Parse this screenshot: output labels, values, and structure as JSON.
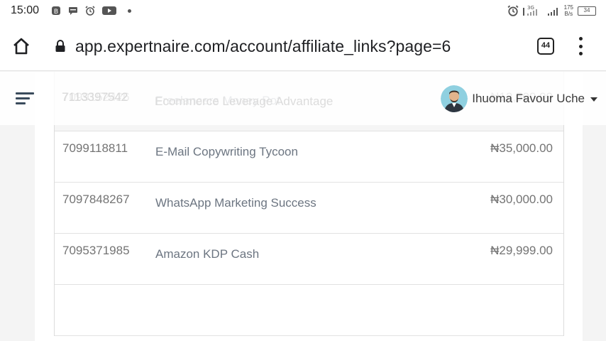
{
  "status_bar": {
    "time": "15:00",
    "network": "3G",
    "speed_value": "175",
    "speed_unit": "B/s",
    "battery": "34"
  },
  "browser": {
    "url": "app.expertnaire.com/account/affiliate_links?page=6",
    "tab_count": "44"
  },
  "header": {
    "user_name": "Ihuoma Favour Uche",
    "ghost_row": {
      "id": "7113397542",
      "name": "Ecommerce Leverage Advantage"
    }
  },
  "rows": [
    {
      "id": "7099152426",
      "name": "Freelancers Money Pot",
      "price": "₦12,500.00"
    },
    {
      "id": "7099118811",
      "name": "E-Mail Copywriting Tycoon",
      "price": "₦35,000.00"
    },
    {
      "id": "7097848267",
      "name": "WhatsApp Marketing Success",
      "price": "₦30,000.00"
    },
    {
      "id": "7095371985",
      "name": "Amazon KDP Cash",
      "price": "₦29,999.00"
    },
    {
      "id": "",
      "name": "",
      "price": ""
    }
  ],
  "colors": {
    "background": "#f4f4f4",
    "text_muted": "#747474",
    "nav_icon": "#3a4b5c"
  }
}
